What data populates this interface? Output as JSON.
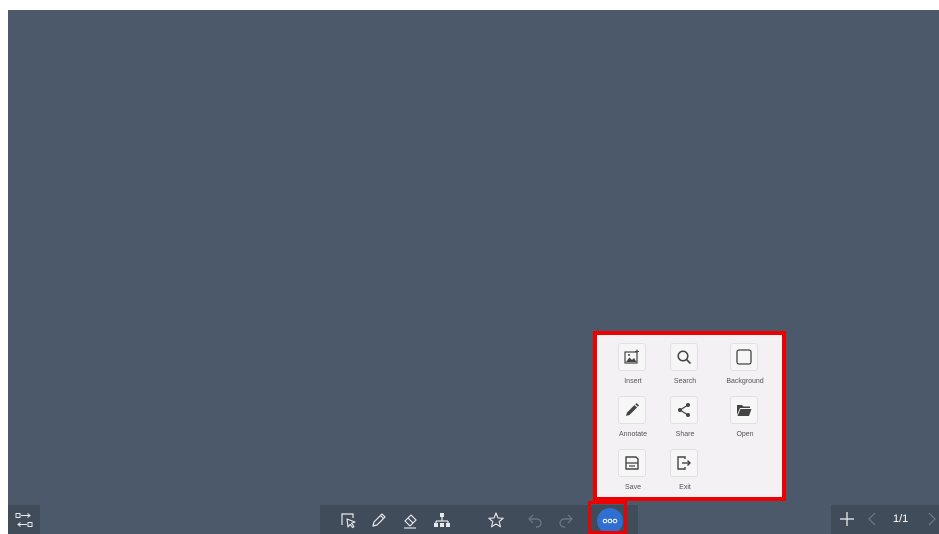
{
  "toolbar": {
    "tools": [
      {
        "name": "select-icon"
      },
      {
        "name": "pen-icon"
      },
      {
        "name": "eraser-icon"
      },
      {
        "name": "mind-map-icon"
      },
      {
        "name": "star-icon"
      },
      {
        "name": "undo-icon"
      },
      {
        "name": "redo-icon"
      }
    ],
    "more_icon": "more-dots-icon"
  },
  "menu": {
    "items": [
      {
        "label": "Insert",
        "icon": "insert-image-icon"
      },
      {
        "label": "Search",
        "icon": "search-icon"
      },
      {
        "label": "Background",
        "icon": "background-icon"
      },
      {
        "label": "Annotate",
        "icon": "annotate-pen-icon"
      },
      {
        "label": "Share",
        "icon": "share-icon"
      },
      {
        "label": "Open",
        "icon": "folder-open-icon"
      },
      {
        "label": "Save",
        "icon": "save-icon"
      },
      {
        "label": "Exit",
        "icon": "exit-icon"
      }
    ]
  },
  "pagenav": {
    "page_indicator": "1/1"
  },
  "colors": {
    "canvas": "#4b596b",
    "toolbar": "#414c5b",
    "accent": "#2f6fd1",
    "highlight": "#ee0000"
  }
}
